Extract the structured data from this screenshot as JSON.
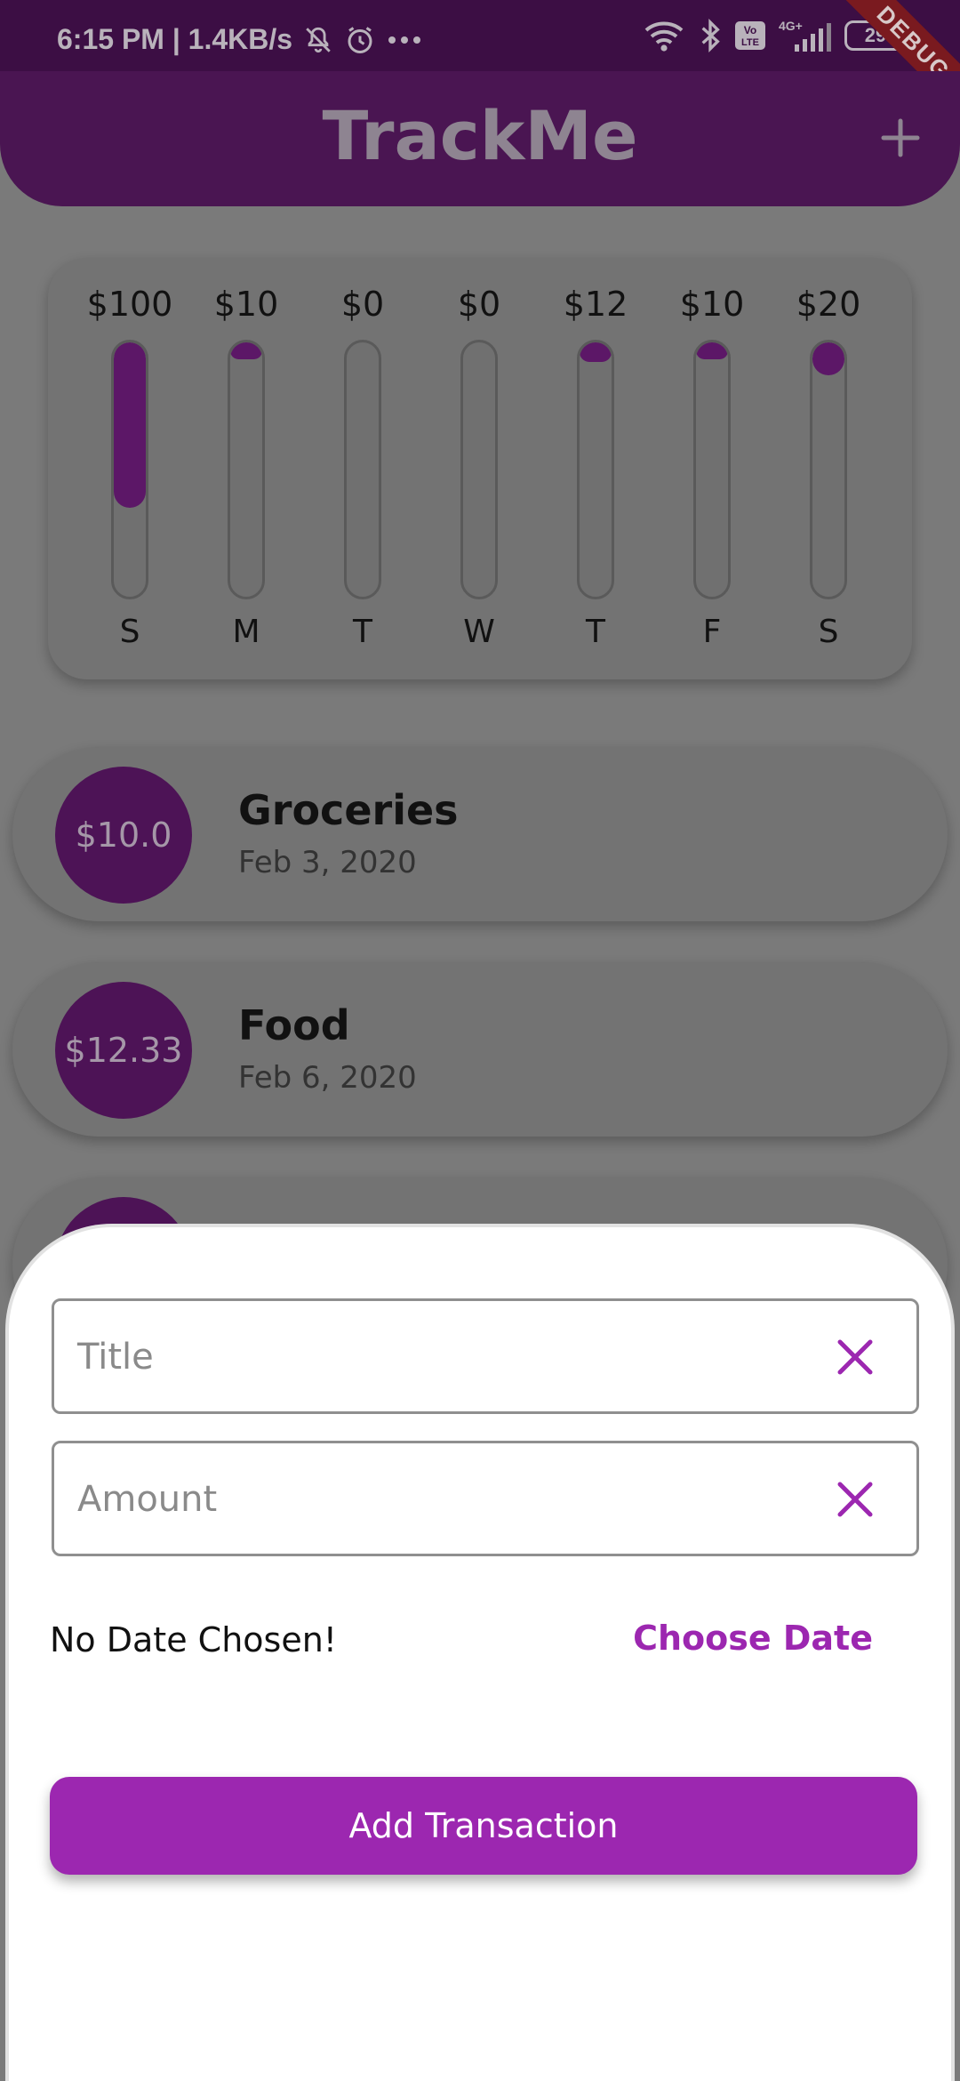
{
  "status_bar": {
    "time_speed": "6:15 PM | 1.4KB/s",
    "network_label": "4G+",
    "volte_label": "Vo LTE",
    "battery": "29",
    "debug_banner": "DEBUG",
    "text_color": "#b9b2bb"
  },
  "app_bar": {
    "title": "TrackMe",
    "add_icon": "plus-icon",
    "color": "#4a1552"
  },
  "chart": {
    "bars": [
      {
        "amount": "$100",
        "day": "S",
        "fraction": 0.65
      },
      {
        "amount": "$10",
        "day": "M",
        "fraction": 0.065
      },
      {
        "amount": "$0",
        "day": "T",
        "fraction": 0
      },
      {
        "amount": "$0",
        "day": "W",
        "fraction": 0
      },
      {
        "amount": "$12",
        "day": "T",
        "fraction": 0.078
      },
      {
        "amount": "$10",
        "day": "F",
        "fraction": 0.065
      },
      {
        "amount": "$20",
        "day": "S",
        "fraction": 0.13
      }
    ],
    "fill_color": "#5c1767"
  },
  "transactions": [
    {
      "amount": "$10.0",
      "title": "Groceries",
      "date": "Feb 3, 2020"
    },
    {
      "amount": "$12.33",
      "title": "Food",
      "date": "Feb 6, 2020"
    }
  ],
  "sheet": {
    "title_placeholder": "Title",
    "amount_placeholder": "Amount",
    "clear_icon": "close-icon",
    "date_label": "No Date Chosen!",
    "choose_date": "Choose Date",
    "submit": "Add Transaction",
    "accent_color": "#9c27b0"
  }
}
